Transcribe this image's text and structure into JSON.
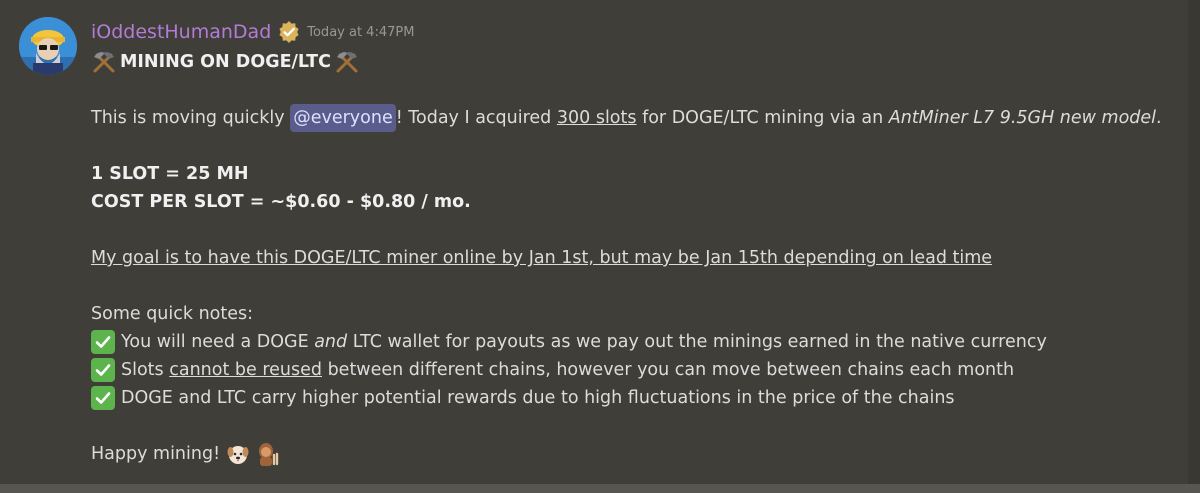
{
  "message": {
    "author": "iOddestHumanDad",
    "verified_icon": "verified-badge-icon",
    "timestamp": "Today at 4:47PM",
    "title": "MINING ON DOGE/LTC",
    "intro": {
      "text1": "This is moving quickly ",
      "mention": "@everyone",
      "text2": "! Today I acquired ",
      "slots_link": "300 slots",
      "text3": " for DOGE/LTC mining via an ",
      "miner_model": "AntMiner L7 9.5GH new model",
      "text4": "."
    },
    "slot_line": "1 SLOT = 25 MH",
    "cost_line": "COST PER SLOT = ~$0.60 - $0.80 / mo.",
    "goal_line": "My goal is to have this DOGE/LTC miner online by Jan 1st, but may be Jan 15th depending on lead time",
    "notes_heading": "Some quick notes:",
    "note1": {
      "a": "You will need a DOGE ",
      "b": "and",
      "c": " LTC wallet for payouts as we pay out the minings earned in the native currency"
    },
    "note2": {
      "a": "Slots ",
      "b": "cannot be reused",
      "c": " between different chains, however you can move between chains each month"
    },
    "note3": "DOGE and LTC carry higher potential rewards due to high fluctuations in the price of the chains",
    "closing": "Happy mining!",
    "accent_colors": {
      "username": "#b37bd6",
      "mention_bg": "#5a5d8c",
      "check": "#5db34c"
    }
  }
}
